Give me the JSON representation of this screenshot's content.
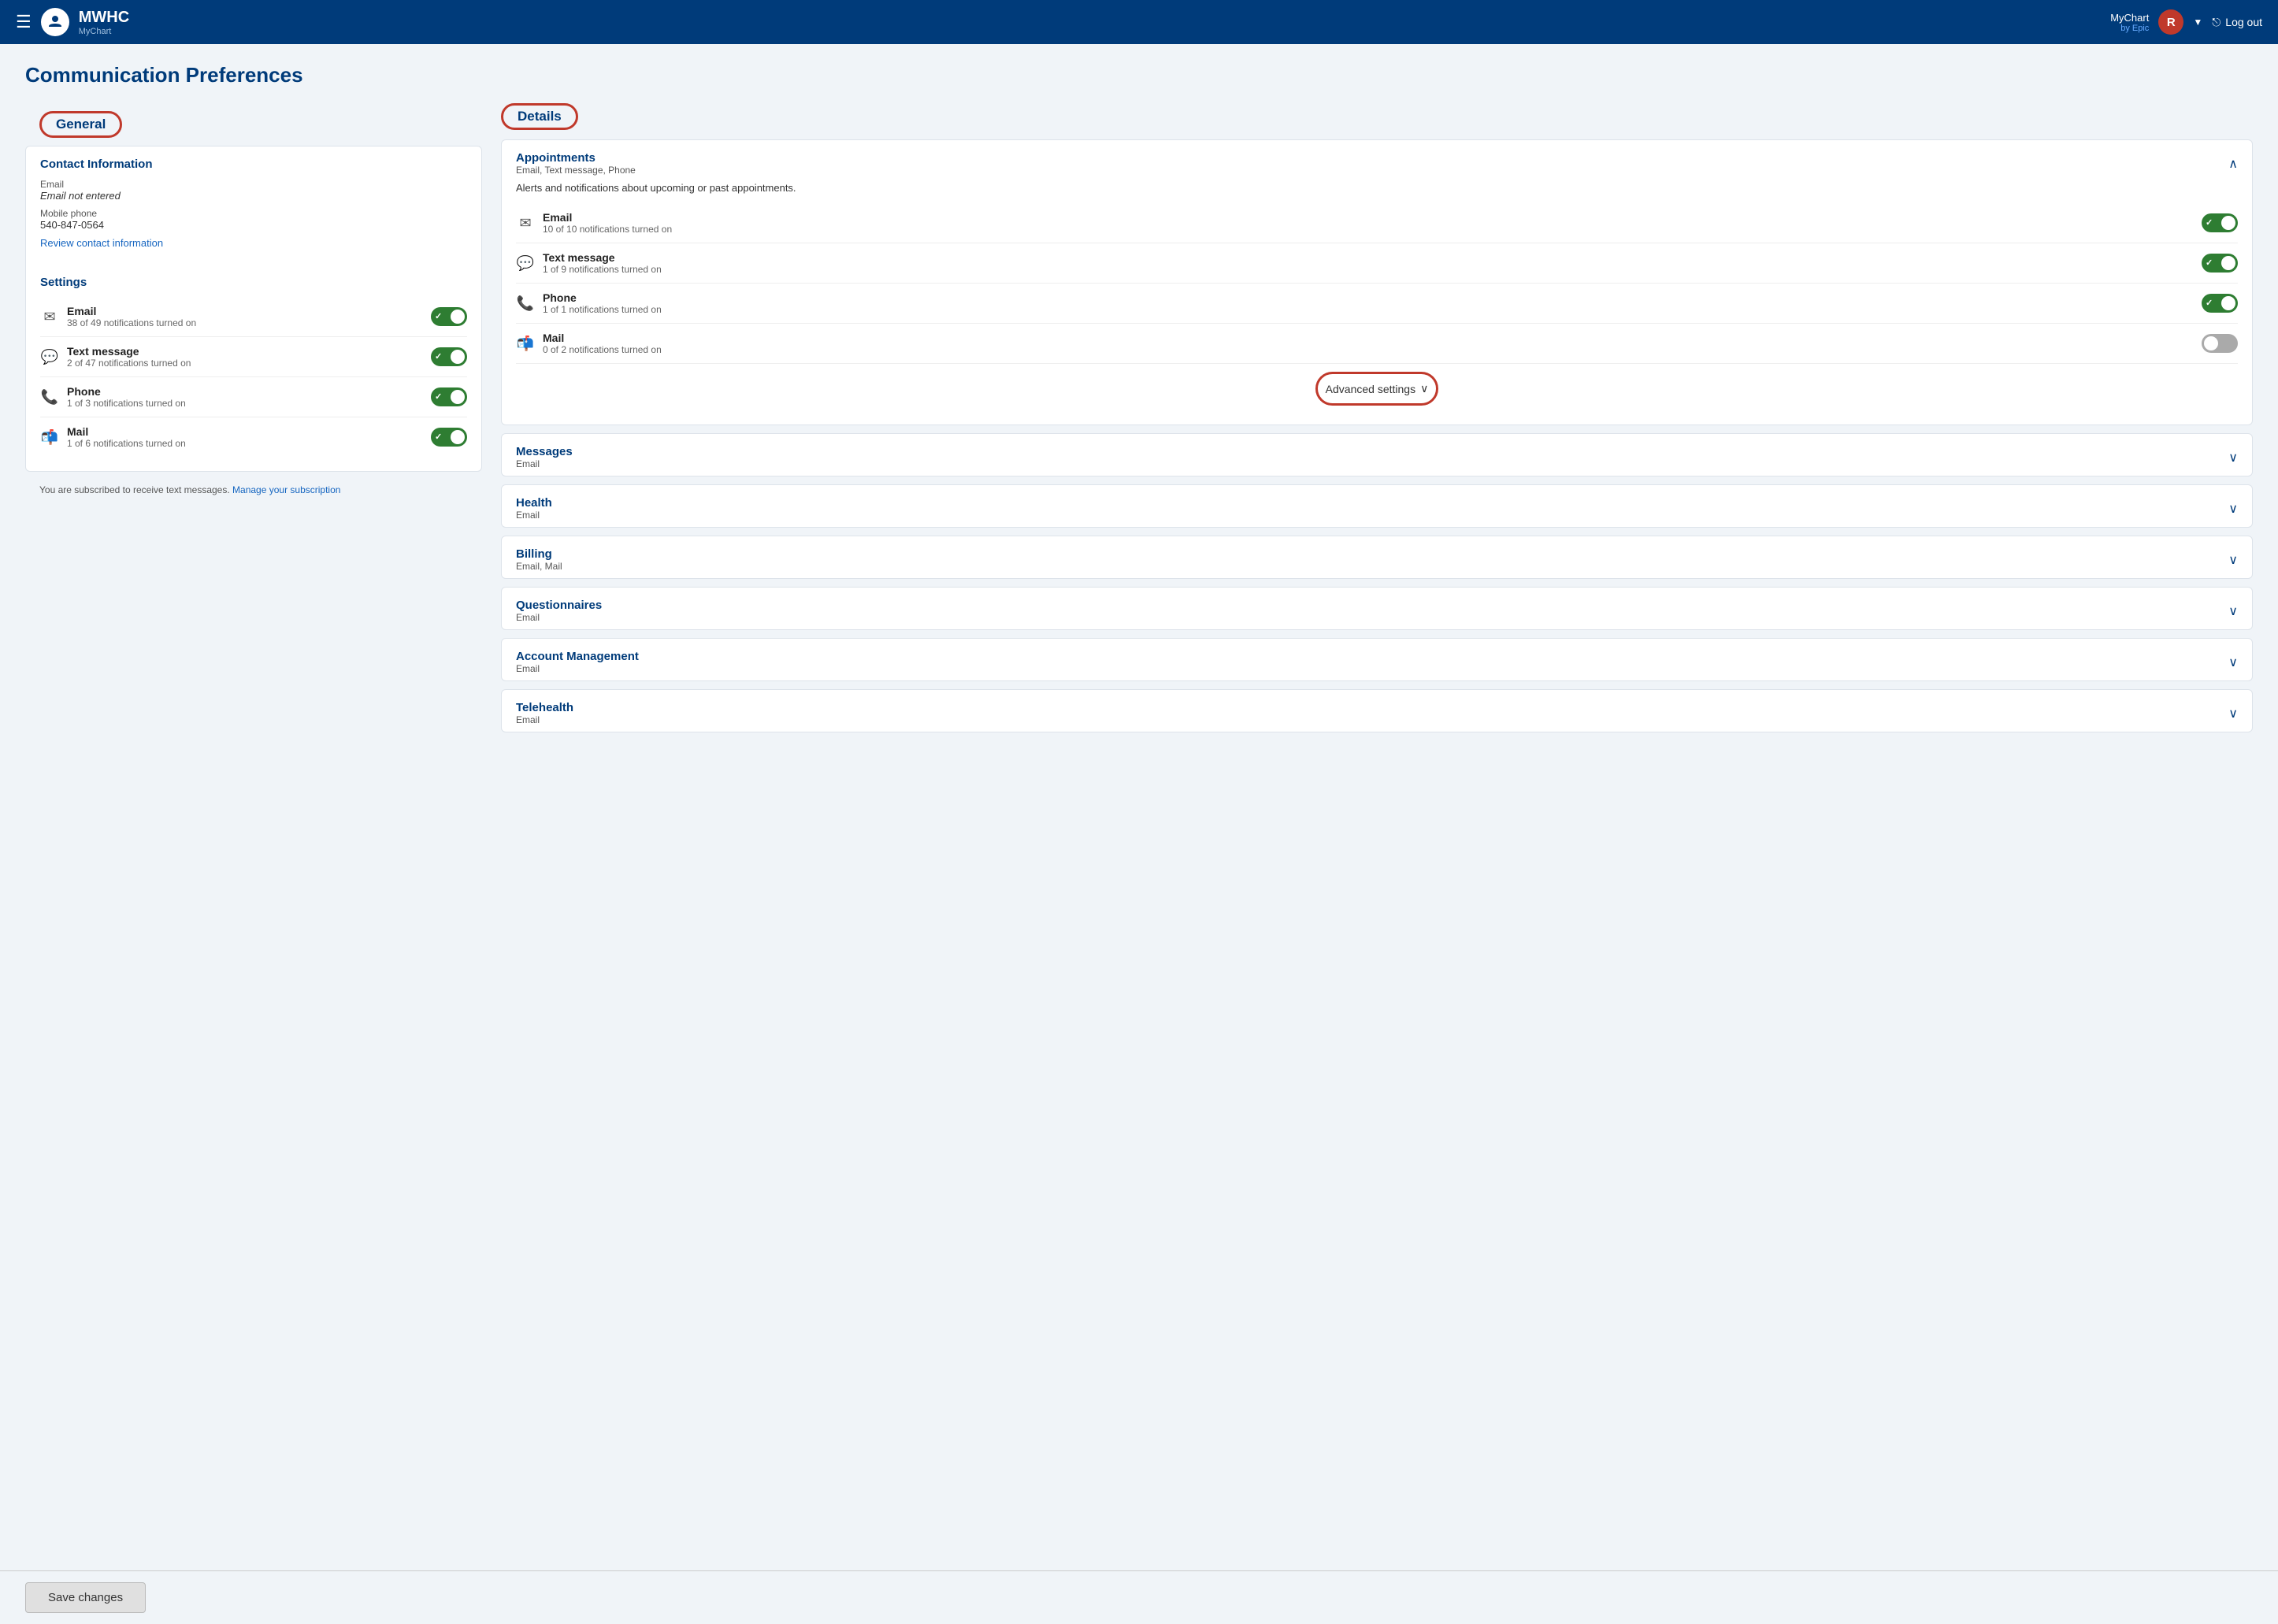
{
  "header": {
    "hamburger_icon": "☰",
    "brand_name": "MWHC",
    "brand_sub": "MyChart",
    "mychart_label": "MyChart",
    "epic_label": "by Epic",
    "user_initial": "R",
    "logout_label": "Log out",
    "logout_icon": "⊕"
  },
  "page": {
    "title": "Communication Preferences"
  },
  "general": {
    "section_label": "General",
    "contact_info": {
      "title": "Contact Information",
      "email_label": "Email",
      "email_value": "Email not entered",
      "phone_label": "Mobile phone",
      "phone_value": "540-847-0564",
      "review_link": "Review contact information"
    },
    "settings": {
      "title": "Settings",
      "items": [
        {
          "icon": "✉",
          "name": "Email",
          "count": "38 of 49 notifications turned on",
          "on": true
        },
        {
          "icon": "💬",
          "name": "Text message",
          "count": "2 of 47 notifications turned on",
          "on": true
        },
        {
          "icon": "📞",
          "name": "Phone",
          "count": "1 of 3 notifications turned on",
          "on": true
        },
        {
          "icon": "📬",
          "name": "Mail",
          "count": "1 of 6 notifications turned on",
          "on": true
        }
      ]
    },
    "subscription_text": "You are subscribed to receive text messages.",
    "subscription_link": "Manage your subscription"
  },
  "details": {
    "section_label": "Details",
    "appointments": {
      "title": "Appointments",
      "subtitle": "Email, Text message, Phone",
      "description": "Alerts and notifications about upcoming or past appointments.",
      "items": [
        {
          "icon": "✉",
          "name": "Email",
          "count": "10 of 10 notifications turned on",
          "on": true
        },
        {
          "icon": "💬",
          "name": "Text message",
          "count": "1 of 9 notifications turned on",
          "on": true
        },
        {
          "icon": "📞",
          "name": "Phone",
          "count": "1 of 1 notifications turned on",
          "on": true
        },
        {
          "icon": "📬",
          "name": "Mail",
          "count": "0 of 2 notifications turned on",
          "on": false
        }
      ],
      "advanced_settings": "Advanced settings"
    },
    "collapsed_sections": [
      {
        "title": "Messages",
        "subtitle": "Email"
      },
      {
        "title": "Health",
        "subtitle": "Email"
      },
      {
        "title": "Billing",
        "subtitle": "Email, Mail"
      },
      {
        "title": "Questionnaires",
        "subtitle": "Email"
      },
      {
        "title": "Account Management",
        "subtitle": "Email"
      },
      {
        "title": "Telehealth",
        "subtitle": "Email"
      }
    ]
  },
  "footer": {
    "save_label": "Save changes"
  }
}
